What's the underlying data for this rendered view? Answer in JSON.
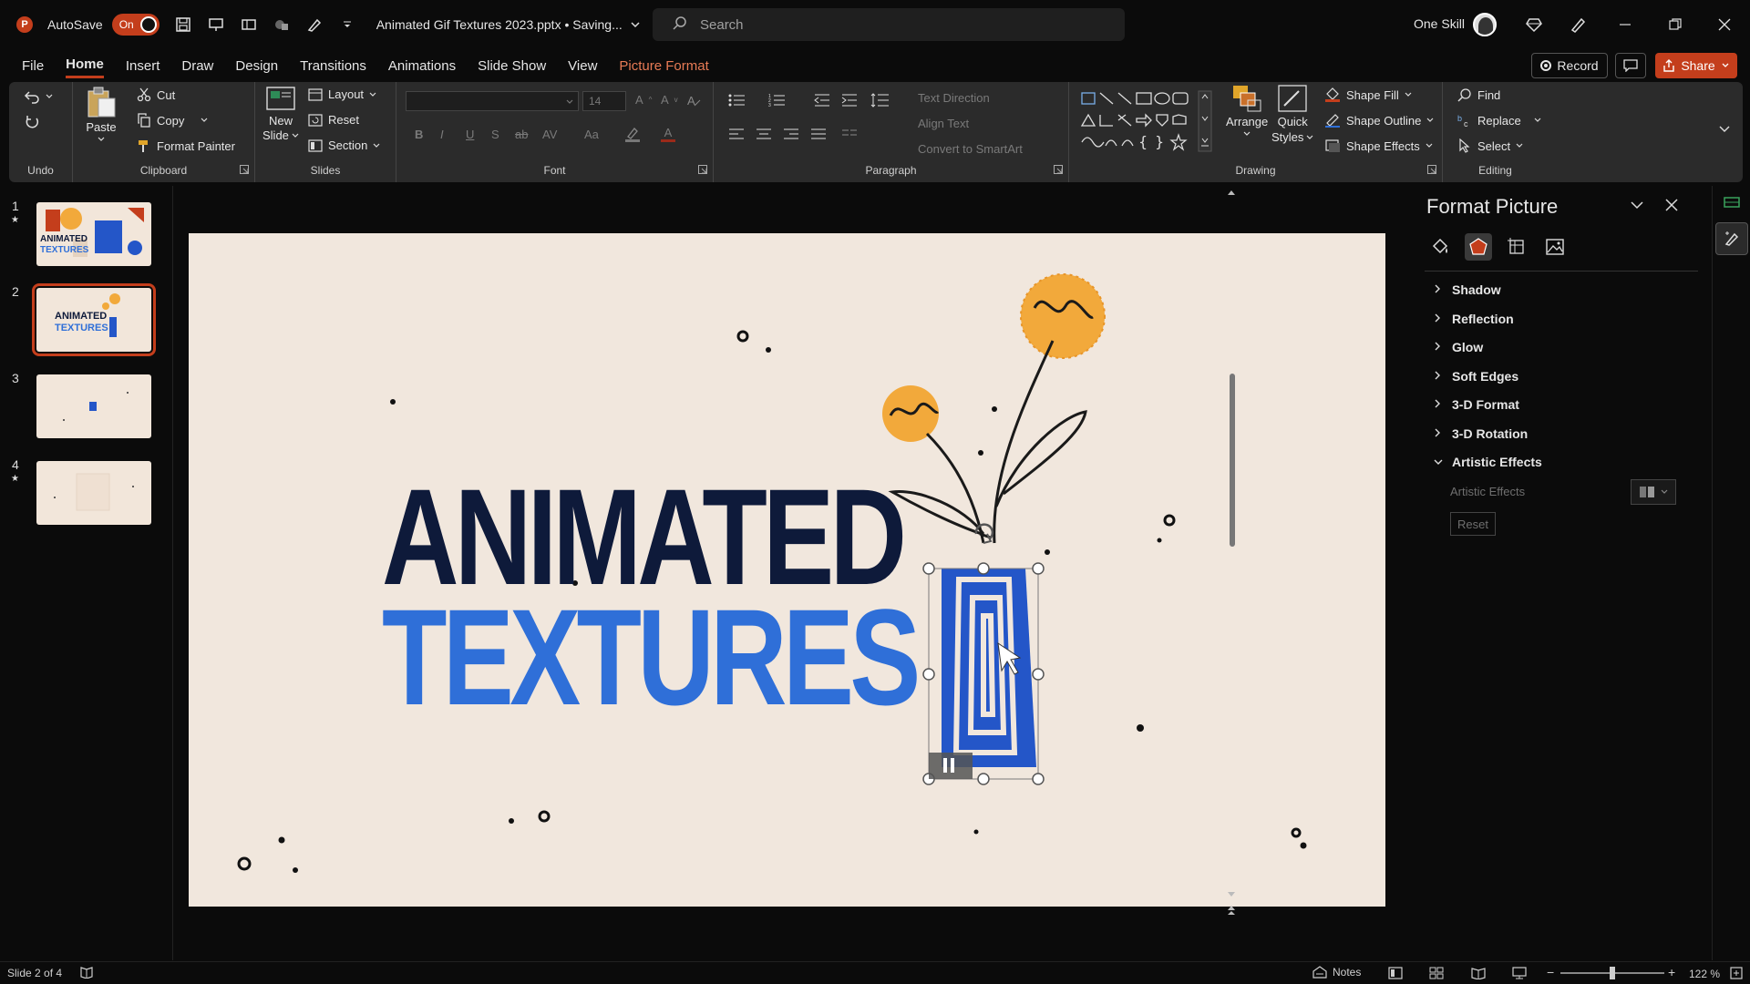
{
  "titlebar": {
    "app_logo": "P",
    "autosave_label": "AutoSave",
    "autosave_state": "On",
    "doc_title": "Animated Gif Textures 2023.pptx • Saving...",
    "search_placeholder": "Search",
    "user_name": "One Skill"
  },
  "menu": {
    "tabs": [
      "File",
      "Home",
      "Insert",
      "Draw",
      "Design",
      "Transitions",
      "Animations",
      "Slide Show",
      "View",
      "Picture Format"
    ],
    "active": "Home",
    "record_label": "Record",
    "share_label": "Share"
  },
  "ribbon": {
    "undo": {
      "label": "Undo"
    },
    "clipboard": {
      "label": "Clipboard",
      "paste": "Paste",
      "cut": "Cut",
      "copy": "Copy",
      "format_painter": "Format Painter"
    },
    "slides": {
      "label": "Slides",
      "new_slide_1": "New",
      "new_slide_2": "Slide",
      "layout": "Layout",
      "reset": "Reset",
      "section": "Section"
    },
    "font": {
      "label": "Font",
      "size": "14",
      "bold": "B",
      "italic": "I",
      "underline": "U",
      "shadow": "S",
      "strike": "ab",
      "spacing": "AV",
      "case": "Aa",
      "font_color": "A"
    },
    "paragraph": {
      "label": "Paragraph",
      "text_direction": "Text Direction",
      "align_text": "Align Text",
      "smartart": "Convert to SmartArt"
    },
    "drawing": {
      "label": "Drawing",
      "arrange": "Arrange",
      "quick_styles_1": "Quick",
      "quick_styles_2": "Styles",
      "shape_fill": "Shape Fill",
      "shape_outline": "Shape Outline",
      "shape_effects": "Shape Effects"
    },
    "editing": {
      "label": "Editing",
      "find": "Find",
      "replace": "Replace",
      "select": "Select"
    }
  },
  "slides_panel": [
    {
      "num": "1",
      "starred": true
    },
    {
      "num": "2",
      "starred": false,
      "active": true
    },
    {
      "num": "3",
      "starred": false
    },
    {
      "num": "4",
      "starred": true
    }
  ],
  "thumb_text": {
    "t1a": "ANIMATED",
    "t1b": "TEXTURES",
    "t2a": "ANIMATED",
    "t2b": "TEXTURES"
  },
  "slide": {
    "title_line_1": "ANIMATED",
    "title_line_2": "TEXTURES",
    "colors": {
      "background": "#f1e7dd",
      "title_dark": "#0e1a3a",
      "title_blue": "#2f6fd8",
      "sun": "#f2a93b",
      "vase_blue": "#2456c8"
    }
  },
  "pane": {
    "title": "Format Picture",
    "sections": [
      {
        "label": "Shadow",
        "expanded": false
      },
      {
        "label": "Reflection",
        "expanded": false
      },
      {
        "label": "Glow",
        "expanded": false
      },
      {
        "label": "Soft Edges",
        "expanded": false
      },
      {
        "label": "3-D Format",
        "expanded": false
      },
      {
        "label": "3-D Rotation",
        "expanded": false
      },
      {
        "label": "Artistic Effects",
        "expanded": true
      }
    ],
    "artistic_effects_label": "Artistic Effects",
    "reset_label": "Reset"
  },
  "status": {
    "slide_indicator": "Slide 2 of 4",
    "notes_label": "Notes",
    "zoom": "122 %"
  }
}
